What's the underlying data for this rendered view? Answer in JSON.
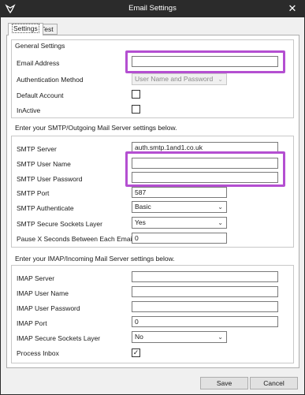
{
  "window": {
    "title": "Email Settings",
    "app_icon": "app-logo-icon",
    "close_icon": "close-icon"
  },
  "tabs": [
    {
      "label": "Settings"
    },
    {
      "label": "Test"
    }
  ],
  "general": {
    "heading": "General Settings",
    "email_address_label": "Email Address",
    "email_address_value": "",
    "auth_method_label": "Authentication Method",
    "auth_method_value": "User Name and Password",
    "default_account_label": "Default Account",
    "inactive_label": "InActive"
  },
  "smtp": {
    "heading": "Enter your SMTP/Outgoing Mail Server settings below.",
    "server_label": "SMTP Server",
    "server_value": "auth.smtp.1and1.co.uk",
    "user_label": "SMTP User Name",
    "user_value": "",
    "password_label": "SMTP User Password",
    "password_value": "",
    "port_label": "SMTP Port",
    "port_value": "587",
    "authenticate_label": "SMTP Authenticate",
    "authenticate_value": "Basic",
    "ssl_label": "SMTP Secure Sockets Layer",
    "ssl_value": "Yes",
    "pause_label": "Pause X Seconds Between Each Email",
    "pause_value": "0"
  },
  "imap": {
    "heading": "Enter your IMAP/Incoming Mail Server settings below.",
    "server_label": "IMAP Server",
    "server_value": "",
    "user_label": "IMAP User Name",
    "user_value": "",
    "password_label": "IMAP User Password",
    "password_value": "",
    "port_label": "IMAP Port",
    "port_value": "0",
    "ssl_label": "IMAP Secure Sockets Layer",
    "ssl_value": "No",
    "process_inbox_label": "Process Inbox",
    "process_inbox_mark": "✓"
  },
  "buttons": {
    "save": "Save",
    "cancel": "Cancel"
  },
  "colors": {
    "titlebar": "#2b2b2b",
    "highlight": "#b44fd1"
  }
}
